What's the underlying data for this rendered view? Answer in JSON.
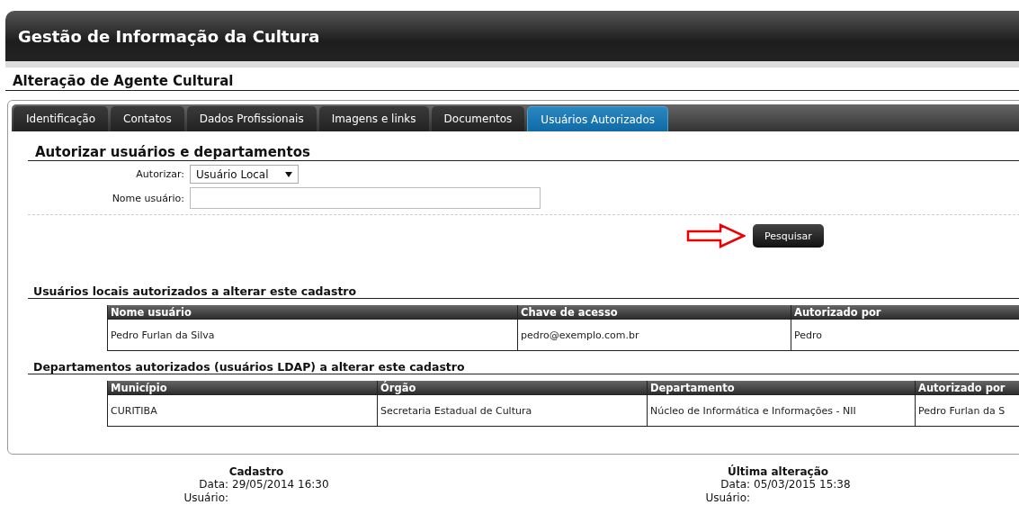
{
  "header": {
    "title": "Gestão de Informação da Cultura"
  },
  "page_title": "Alteração de Agente Cultural",
  "tabs": [
    {
      "label": "Identificação",
      "selected": false
    },
    {
      "label": "Contatos",
      "selected": false
    },
    {
      "label": "Dados Profissionais",
      "selected": false
    },
    {
      "label": "Imagens e links",
      "selected": false
    },
    {
      "label": "Documentos",
      "selected": false
    },
    {
      "label": "Usuários Autorizados",
      "selected": true
    }
  ],
  "section_title": "Autorizar usuários e departamentos",
  "form": {
    "authorize_label": "Autorizar:",
    "authorize_value": "Usuário Local",
    "username_label": "Nome usuário:"
  },
  "search_button": "Pesquisar",
  "local_users": {
    "title": "Usuários locais autorizados a alterar este cadastro",
    "columns": [
      "Nome usuário",
      "Chave de acesso",
      "Autorizado por"
    ],
    "rows": [
      [
        "Pedro Furlan da Silva",
        "pedro@exemplo.com.br",
        "Pedro"
      ]
    ]
  },
  "departments": {
    "title": "Departamentos autorizados (usuários LDAP) a alterar este cadastro",
    "columns": [
      "Município",
      "Órgão",
      "Departamento",
      "Autorizado por"
    ],
    "rows": [
      [
        "CURITIBA",
        "Secretaria Estadual de Cultura",
        "Núcleo de Informática e Informações - NII",
        "Pedro Furlan da S"
      ]
    ]
  },
  "footer": [
    {
      "title": "Cadastro",
      "date_label": "Data:",
      "date": "29/05/2014 16:30",
      "user_label": "Usuário:"
    },
    {
      "title": "Última alteração",
      "date_label": "Data:",
      "date": "05/03/2015 15:38",
      "user_label": "Usuário:"
    }
  ]
}
